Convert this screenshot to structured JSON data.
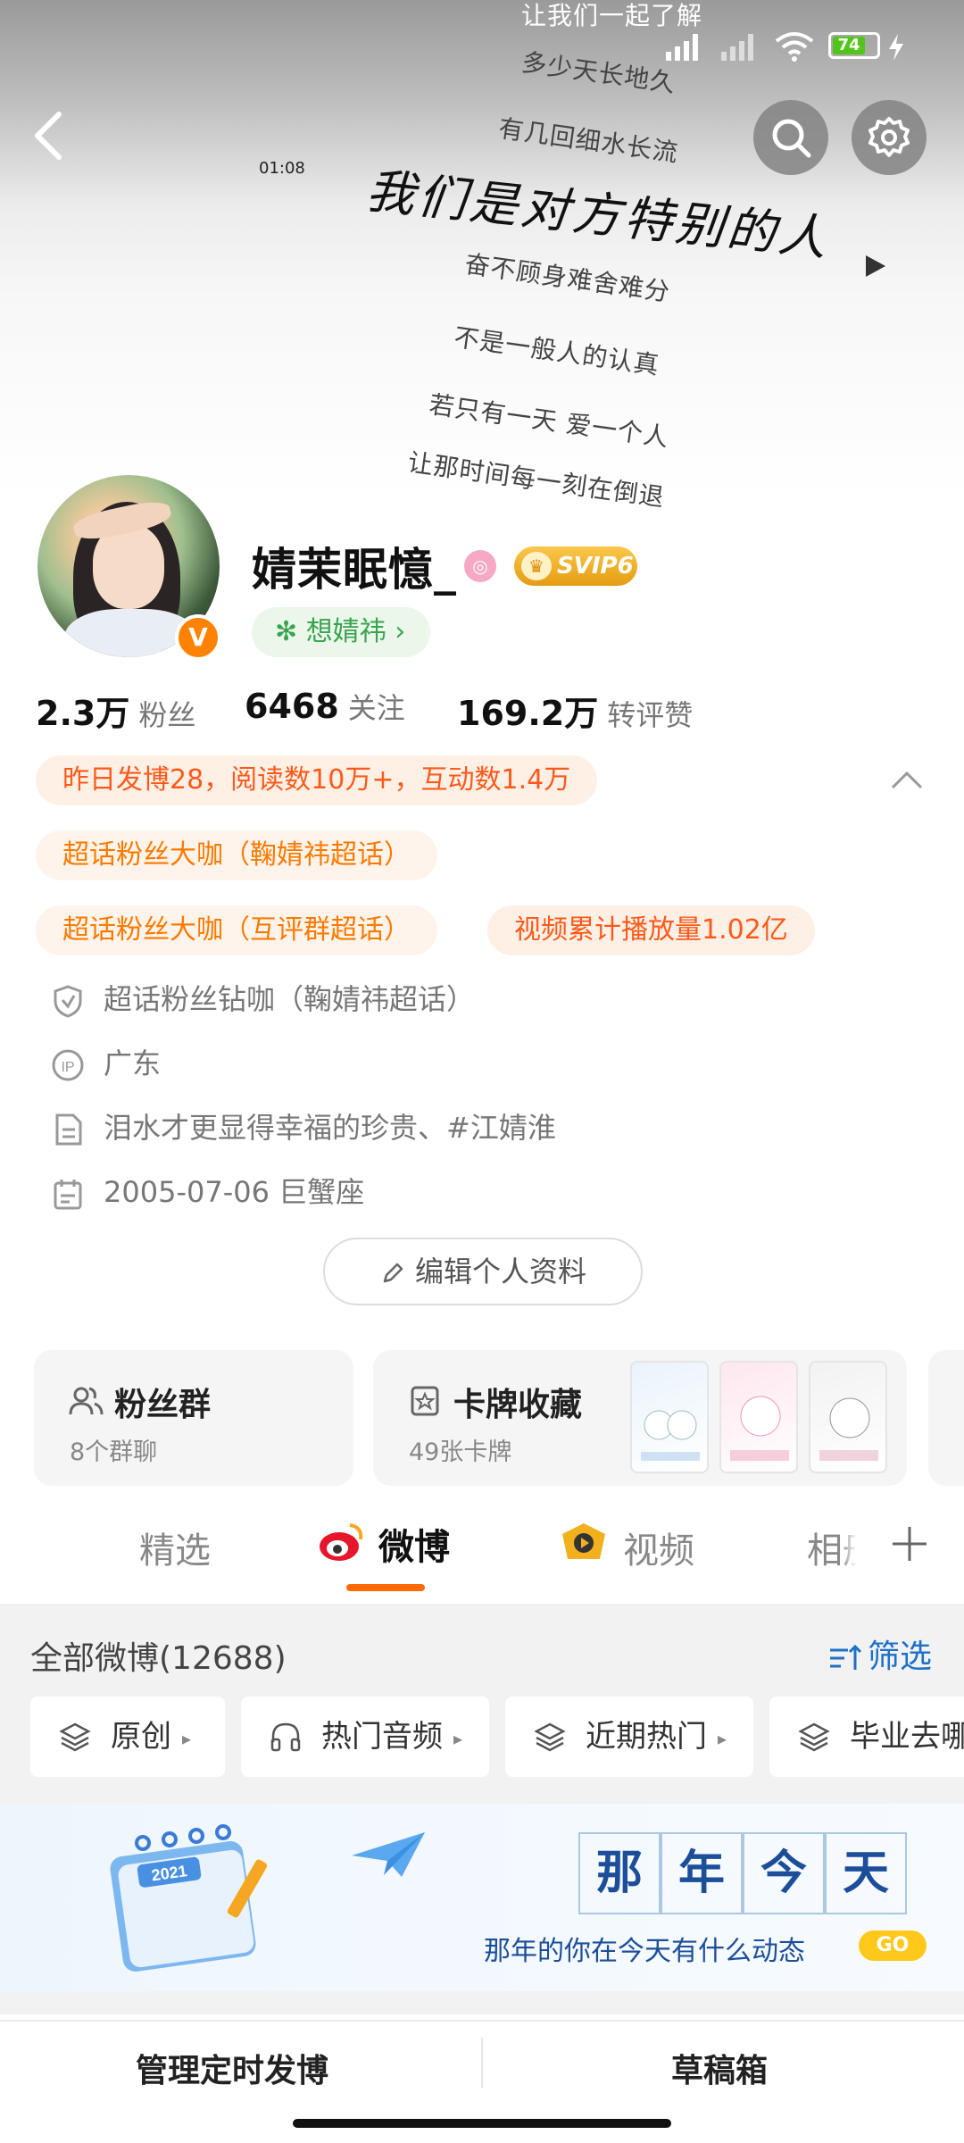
{
  "banner": {
    "lyrics": [
      "让我们一起了解",
      "多少天长地久",
      "有几回细水长流",
      "我们是对方特别的人",
      "奋不顾身难舍难分",
      "不是一般人的认真",
      "若只有一天 爱一个人",
      "让那时间每一刻在倒退"
    ],
    "timestamp": "01:08"
  },
  "status_bar": {
    "battery": "74"
  },
  "profile": {
    "username": "婧茉眠憶_",
    "svip": "SVIP6",
    "fan_club": "想婧祎",
    "stats": [
      {
        "value": "2.3万",
        "label": "粉丝"
      },
      {
        "value": "6468",
        "label": "关注"
      },
      {
        "value": "169.2万",
        "label": "转评赞"
      }
    ],
    "highlights": [
      "昨日发博28，阅读数10万+，互动数1.4万",
      "超话粉丝大咖（鞠婧祎超话）",
      "超话粉丝大咖（互评群超话）",
      "视频累计播放量1.02亿"
    ],
    "info": {
      "badge": "超话粉丝钻咖（鞠婧祎超话）",
      "ip": "广东",
      "bio": "泪水才更显得幸福的珍贵、#江婧淮",
      "birthday": "2005-07-06 巨蟹座"
    },
    "edit_button": "编辑个人资料"
  },
  "cards": {
    "fans_group": {
      "title": "粉丝群",
      "subtitle": "8个群聊"
    },
    "card_collection": {
      "title": "卡牌收藏",
      "subtitle": "49张卡牌"
    }
  },
  "tabs": [
    "精选",
    "微博",
    "视频",
    "相册"
  ],
  "feed": {
    "all_label": "全部微博(12688)",
    "filter_label": "筛选",
    "chips": [
      "原创",
      "热门音频",
      "近期热门",
      "毕业去哪"
    ]
  },
  "memory": {
    "chars": [
      "那",
      "年",
      "今",
      "天"
    ],
    "calendar_year": "2021",
    "subtitle": "那年的你在今天有什么动态",
    "go": "GO"
  },
  "bottom": {
    "left": "管理定时发博",
    "right": "草稿箱"
  }
}
